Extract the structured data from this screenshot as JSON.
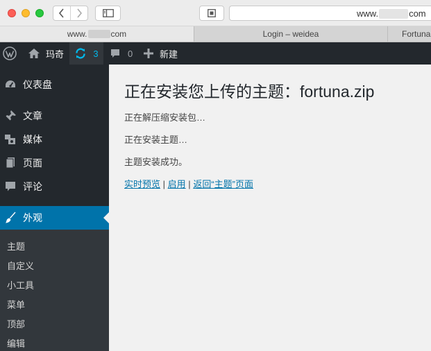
{
  "browser": {
    "address": {
      "prefix": "www.",
      "suffix": "com"
    },
    "tabs": [
      {
        "prefix": "www.",
        "suffix": "com",
        "active": true
      },
      {
        "label": "Login – weidea",
        "active": false
      },
      {
        "label": "Fortuna",
        "active": false
      }
    ]
  },
  "adminbar": {
    "site_name": "玛奇",
    "updates_count": "3",
    "comments_count": "0",
    "new_label": "新建"
  },
  "sidebar": {
    "items": [
      {
        "label": "仪表盘",
        "icon": "dashboard-icon"
      },
      {
        "label": "文章",
        "icon": "pushpin-icon"
      },
      {
        "label": "媒体",
        "icon": "media-icon"
      },
      {
        "label": "页面",
        "icon": "page-icon"
      },
      {
        "label": "评论",
        "icon": "comment-icon"
      },
      {
        "label": "外观",
        "icon": "paintbrush-icon",
        "current": true
      }
    ],
    "submenu": [
      "主题",
      "自定义",
      "小工具",
      "菜单",
      "顶部",
      "编辑"
    ]
  },
  "main": {
    "title": "正在安装您上传的主题：fortuna.zip",
    "messages": [
      "正在解压缩安装包…",
      "正在安装主题…",
      "主题安装成功。"
    ],
    "links": {
      "preview": "实时预览",
      "activate": "启用",
      "back": "返回“主题”页面",
      "separator": "|"
    }
  },
  "colors": {
    "admin_bar": "#23282d",
    "sidebar": "#23282d",
    "submenu": "#32373c",
    "accent": "#0073aa",
    "updates_icon": "#00b9eb"
  }
}
